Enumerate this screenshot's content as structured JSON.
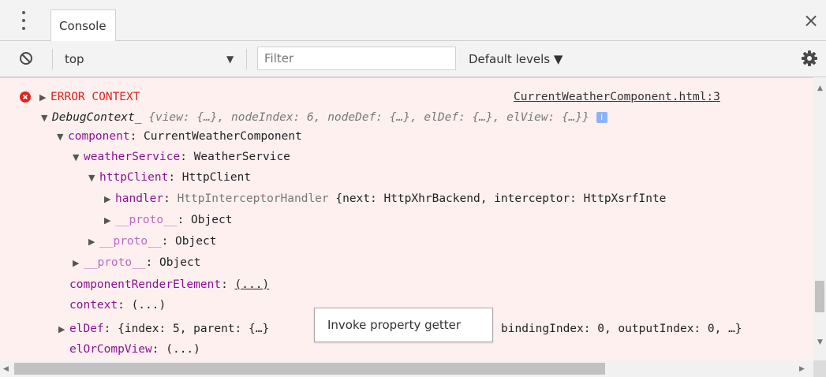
{
  "tabbar": {
    "tab_label": "Console",
    "close_glyph": "×"
  },
  "toolbar": {
    "context_label": "top",
    "filter_placeholder": "Filter",
    "levels_label": "Default levels ▼"
  },
  "console": {
    "error_label": "ERROR CONTEXT",
    "source_link": "CurrentWeatherComponent.html:3",
    "debug_name": "DebugContext_",
    "debug_summary": " {view: {…}, nodeIndex: 6, nodeDef: {…}, elDef: {…}, elView: {…}}",
    "info_badge": "i",
    "component_key": "component",
    "component_val": "CurrentWeatherComponent",
    "weather_key": "weatherService",
    "weather_val": "WeatherService",
    "http_key": "httpClient",
    "http_val": "HttpClient",
    "handler_key": "handler",
    "handler_type": "HttpInterceptorHandler",
    "handler_summary": " {next: HttpXhrBackend, interceptor: HttpXsrfInte",
    "proto_key": "__proto__",
    "proto_val": "Object",
    "cre_key": "componentRenderElement",
    "getter_val": "(...)",
    "context_key": "context",
    "eldef_key": "elDef",
    "eldef_left": "{index: 5, parent: {…}",
    "eldef_right": " bindingIndex: 0, outputIndex: 0, …}",
    "elorcomp_key": "elOrCompView"
  },
  "tooltip": {
    "text": "Invoke property getter"
  },
  "colors": {
    "error": "#e0241b",
    "key": "#881391",
    "background": "#fff0f0"
  },
  "icons": [
    "kebab-menu-icon",
    "clear-console-icon",
    "error-icon",
    "info-icon",
    "gear-icon",
    "close-icon"
  ]
}
